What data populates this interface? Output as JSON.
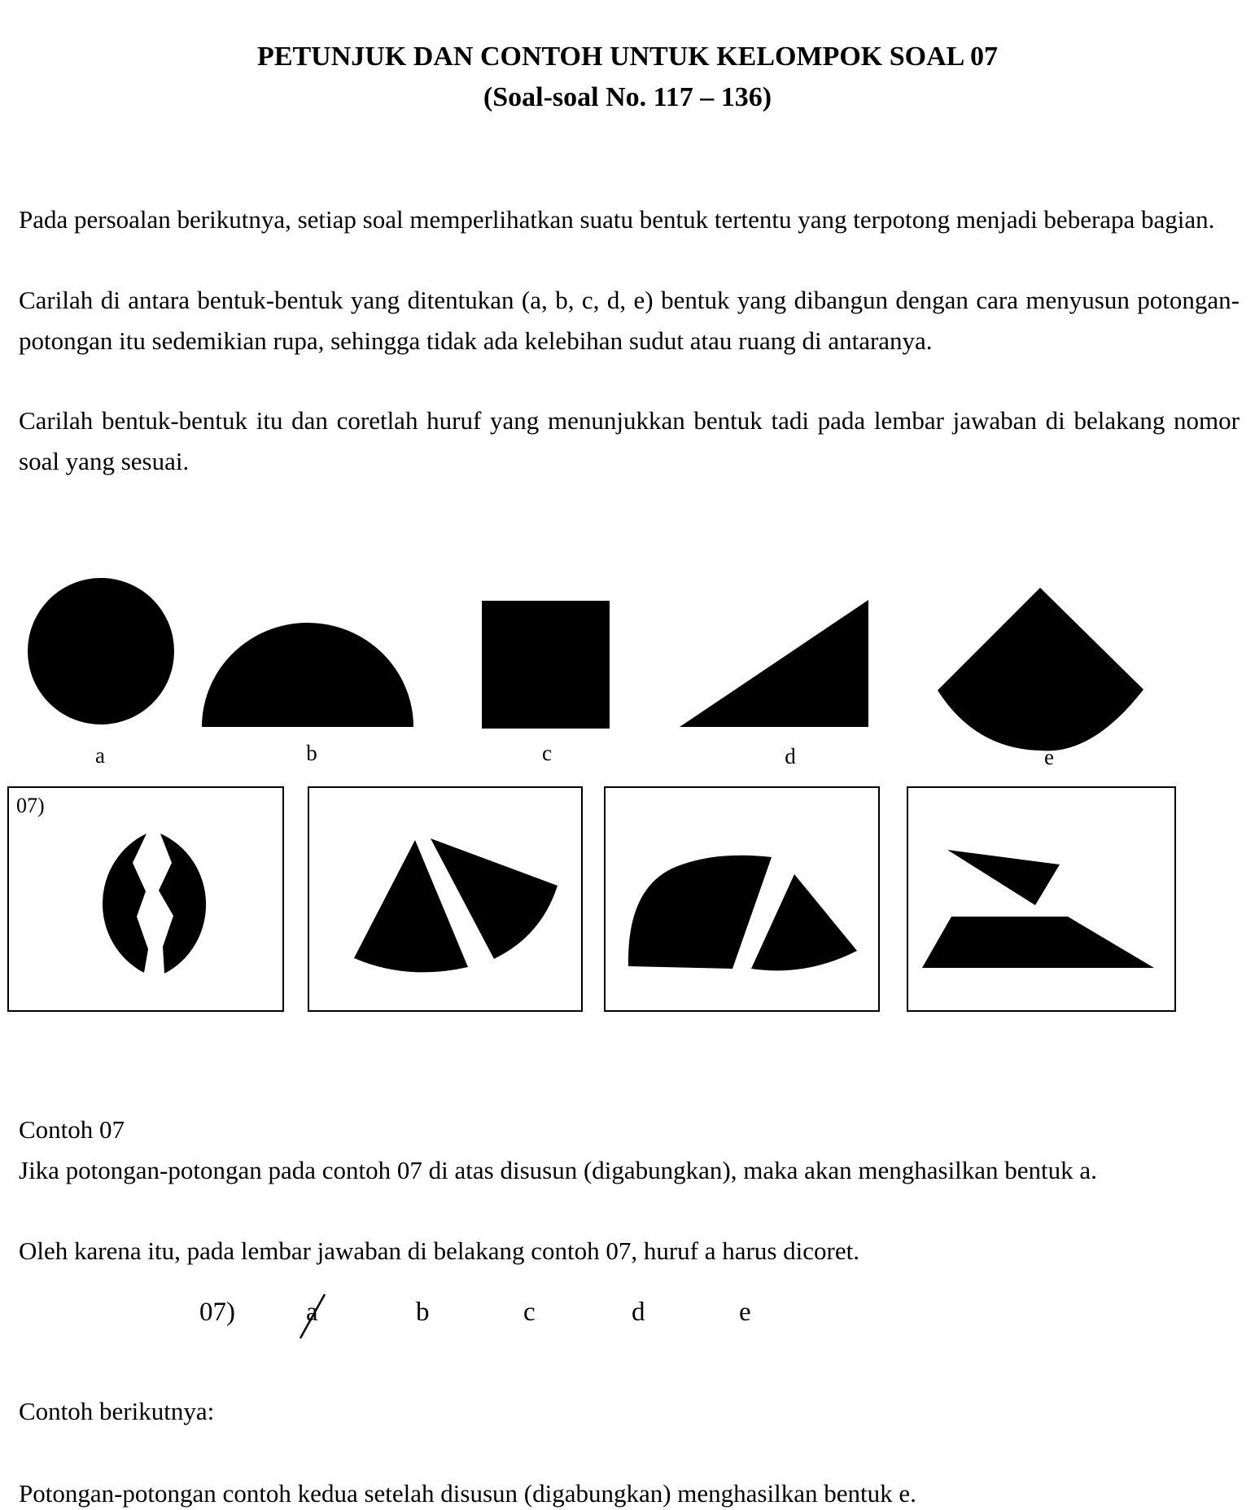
{
  "header": {
    "title": "PETUNJUK DAN CONTOH UNTUK KELOMPOK SOAL 07",
    "subtitle": "(Soal-soal No. 117 – 136)"
  },
  "instructions": [
    "Pada persoalan berikutnya, setiap soal memperlihatkan suatu bentuk tertentu yang terpotong menjadi beberapa bagian.",
    "Carilah di antara bentuk-bentuk yang ditentukan (a, b, c, d, e) bentuk yang dibangun dengan cara menyusun potongan-potongan itu sedemikian rupa, sehingga tidak ada kelebihan sudut atau ruang di antaranya.",
    "Carilah bentuk-bentuk itu dan coretlah huruf yang menunjukkan bentuk tadi pada lembar jawaban di belakang nomor soal yang sesuai."
  ],
  "shapes": [
    {
      "label": "a",
      "icon": "circle-shape"
    },
    {
      "label": "b",
      "icon": "semicircle-shape"
    },
    {
      "label": "c",
      "icon": "square-shape"
    },
    {
      "label": "d",
      "icon": "right-triangle-shape"
    },
    {
      "label": "e",
      "icon": "circle-sector-shape"
    }
  ],
  "example_box_label": "07)",
  "example": {
    "heading": "Contoh 07",
    "text1": "Jika potongan-potongan pada contoh 07 di atas disusun (digabungkan), maka akan menghasilkan bentuk a.",
    "text2": "Oleh karena itu, pada lembar jawaban di belakang contoh 07, huruf a harus dicoret."
  },
  "answer_row": {
    "number": "07)",
    "options": [
      "a",
      "b",
      "c",
      "d",
      "e"
    ],
    "crossed_option": "a"
  },
  "next_heading": "Contoh berikutnya:",
  "next_text": "Potongan-potongan contoh kedua setelah disusun (digabungkan) menghasilkan bentuk e."
}
